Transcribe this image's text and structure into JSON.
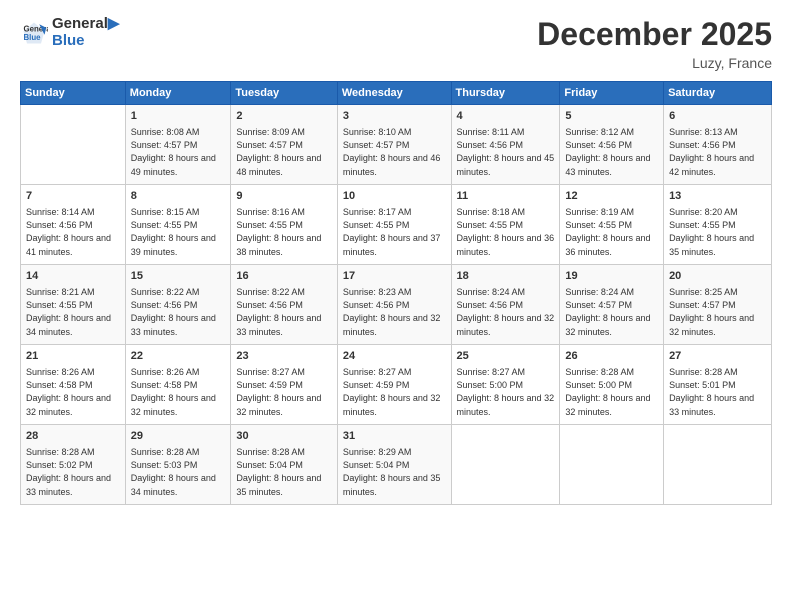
{
  "header": {
    "logo_line1": "General",
    "logo_line2": "Blue",
    "title": "December 2025",
    "location": "Luzy, France"
  },
  "days_of_week": [
    "Sunday",
    "Monday",
    "Tuesday",
    "Wednesday",
    "Thursday",
    "Friday",
    "Saturday"
  ],
  "weeks": [
    [
      {
        "day": "",
        "sunrise": "",
        "sunset": "",
        "daylight": ""
      },
      {
        "day": "1",
        "sunrise": "8:08 AM",
        "sunset": "4:57 PM",
        "daylight": "8 hours and 49 minutes."
      },
      {
        "day": "2",
        "sunrise": "8:09 AM",
        "sunset": "4:57 PM",
        "daylight": "8 hours and 48 minutes."
      },
      {
        "day": "3",
        "sunrise": "8:10 AM",
        "sunset": "4:57 PM",
        "daylight": "8 hours and 46 minutes."
      },
      {
        "day": "4",
        "sunrise": "8:11 AM",
        "sunset": "4:56 PM",
        "daylight": "8 hours and 45 minutes."
      },
      {
        "day": "5",
        "sunrise": "8:12 AM",
        "sunset": "4:56 PM",
        "daylight": "8 hours and 43 minutes."
      },
      {
        "day": "6",
        "sunrise": "8:13 AM",
        "sunset": "4:56 PM",
        "daylight": "8 hours and 42 minutes."
      }
    ],
    [
      {
        "day": "7",
        "sunrise": "8:14 AM",
        "sunset": "4:56 PM",
        "daylight": "8 hours and 41 minutes."
      },
      {
        "day": "8",
        "sunrise": "8:15 AM",
        "sunset": "4:55 PM",
        "daylight": "8 hours and 39 minutes."
      },
      {
        "day": "9",
        "sunrise": "8:16 AM",
        "sunset": "4:55 PM",
        "daylight": "8 hours and 38 minutes."
      },
      {
        "day": "10",
        "sunrise": "8:17 AM",
        "sunset": "4:55 PM",
        "daylight": "8 hours and 37 minutes."
      },
      {
        "day": "11",
        "sunrise": "8:18 AM",
        "sunset": "4:55 PM",
        "daylight": "8 hours and 36 minutes."
      },
      {
        "day": "12",
        "sunrise": "8:19 AM",
        "sunset": "4:55 PM",
        "daylight": "8 hours and 36 minutes."
      },
      {
        "day": "13",
        "sunrise": "8:20 AM",
        "sunset": "4:55 PM",
        "daylight": "8 hours and 35 minutes."
      }
    ],
    [
      {
        "day": "14",
        "sunrise": "8:21 AM",
        "sunset": "4:55 PM",
        "daylight": "8 hours and 34 minutes."
      },
      {
        "day": "15",
        "sunrise": "8:22 AM",
        "sunset": "4:56 PM",
        "daylight": "8 hours and 33 minutes."
      },
      {
        "day": "16",
        "sunrise": "8:22 AM",
        "sunset": "4:56 PM",
        "daylight": "8 hours and 33 minutes."
      },
      {
        "day": "17",
        "sunrise": "8:23 AM",
        "sunset": "4:56 PM",
        "daylight": "8 hours and 32 minutes."
      },
      {
        "day": "18",
        "sunrise": "8:24 AM",
        "sunset": "4:56 PM",
        "daylight": "8 hours and 32 minutes."
      },
      {
        "day": "19",
        "sunrise": "8:24 AM",
        "sunset": "4:57 PM",
        "daylight": "8 hours and 32 minutes."
      },
      {
        "day": "20",
        "sunrise": "8:25 AM",
        "sunset": "4:57 PM",
        "daylight": "8 hours and 32 minutes."
      }
    ],
    [
      {
        "day": "21",
        "sunrise": "8:26 AM",
        "sunset": "4:58 PM",
        "daylight": "8 hours and 32 minutes."
      },
      {
        "day": "22",
        "sunrise": "8:26 AM",
        "sunset": "4:58 PM",
        "daylight": "8 hours and 32 minutes."
      },
      {
        "day": "23",
        "sunrise": "8:27 AM",
        "sunset": "4:59 PM",
        "daylight": "8 hours and 32 minutes."
      },
      {
        "day": "24",
        "sunrise": "8:27 AM",
        "sunset": "4:59 PM",
        "daylight": "8 hours and 32 minutes."
      },
      {
        "day": "25",
        "sunrise": "8:27 AM",
        "sunset": "5:00 PM",
        "daylight": "8 hours and 32 minutes."
      },
      {
        "day": "26",
        "sunrise": "8:28 AM",
        "sunset": "5:00 PM",
        "daylight": "8 hours and 32 minutes."
      },
      {
        "day": "27",
        "sunrise": "8:28 AM",
        "sunset": "5:01 PM",
        "daylight": "8 hours and 33 minutes."
      }
    ],
    [
      {
        "day": "28",
        "sunrise": "8:28 AM",
        "sunset": "5:02 PM",
        "daylight": "8 hours and 33 minutes."
      },
      {
        "day": "29",
        "sunrise": "8:28 AM",
        "sunset": "5:03 PM",
        "daylight": "8 hours and 34 minutes."
      },
      {
        "day": "30",
        "sunrise": "8:28 AM",
        "sunset": "5:04 PM",
        "daylight": "8 hours and 35 minutes."
      },
      {
        "day": "31",
        "sunrise": "8:29 AM",
        "sunset": "5:04 PM",
        "daylight": "8 hours and 35 minutes."
      },
      {
        "day": "",
        "sunrise": "",
        "sunset": "",
        "daylight": ""
      },
      {
        "day": "",
        "sunrise": "",
        "sunset": "",
        "daylight": ""
      },
      {
        "day": "",
        "sunrise": "",
        "sunset": "",
        "daylight": ""
      }
    ]
  ]
}
